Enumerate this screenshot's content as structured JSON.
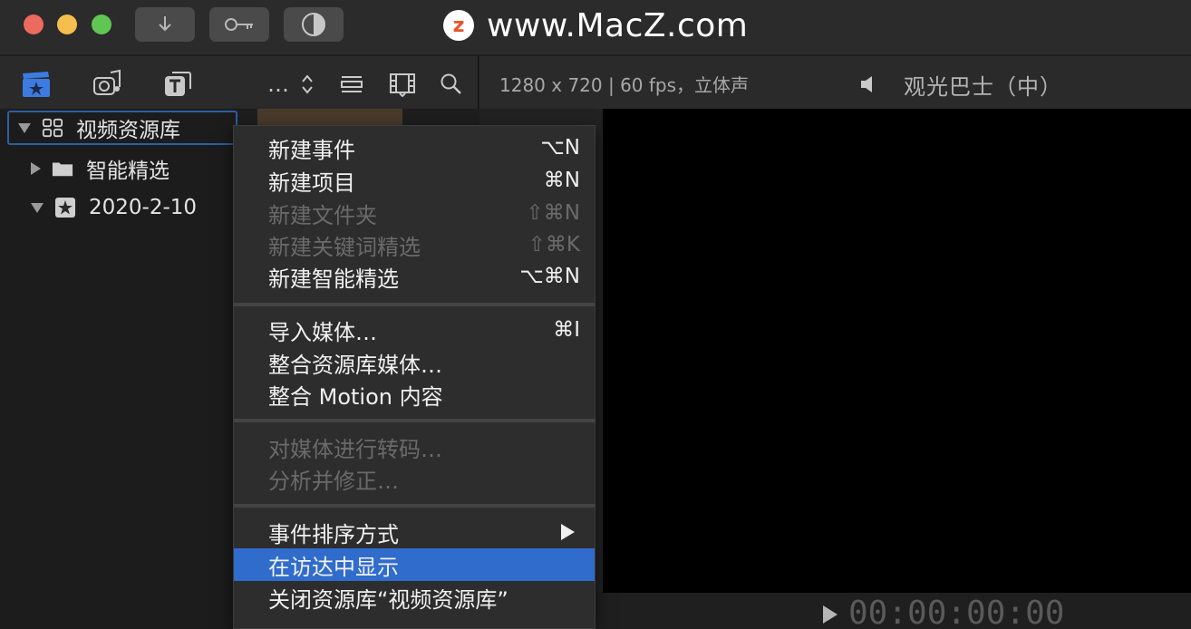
{
  "titlebar": {
    "watermark_logo": "z",
    "watermark_text": "www.MacZ.com",
    "buttons": [
      "download-icon",
      "key-icon",
      "half-circle-icon"
    ]
  },
  "browser_toolbar": {
    "icons": [
      "clapboard-star-icon",
      "music-camera-icon",
      "titles-icon",
      "more-icon",
      "updown-chevron-icon",
      "filmstrip-list-icon",
      "clip-appearance-icon",
      "search-icon"
    ],
    "more_label": "…"
  },
  "viewer_toolbar": {
    "format_info": "1280 x 720 | 60 fps，立体声",
    "project_title": "观光巴士（中）"
  },
  "sidebar": {
    "items": [
      {
        "label": "视频资源库",
        "icon": "library-grid-icon",
        "expanded": true
      },
      {
        "label": "智能精选",
        "icon": "folder-icon",
        "expanded": false
      },
      {
        "label": "2020-2-10",
        "icon": "event-star-icon",
        "expanded": true
      }
    ]
  },
  "context_menu": {
    "groups": [
      [
        {
          "label": "新建事件",
          "shortcut": "⌥N",
          "disabled": false
        },
        {
          "label": "新建项目",
          "shortcut": "⌘N",
          "disabled": false
        },
        {
          "label": "新建文件夹",
          "shortcut": "⇧⌘N",
          "disabled": true
        },
        {
          "label": "新建关键词精选",
          "shortcut": "⇧⌘K",
          "disabled": true
        },
        {
          "label": "新建智能精选",
          "shortcut": "⌥⌘N",
          "disabled": false
        }
      ],
      [
        {
          "label": "导入媒体…",
          "shortcut": "⌘I",
          "disabled": false
        },
        {
          "label": "整合资源库媒体…",
          "shortcut": "",
          "disabled": false
        },
        {
          "label": "整合 Motion 内容",
          "shortcut": "",
          "disabled": false
        }
      ],
      [
        {
          "label": "对媒体进行转码…",
          "shortcut": "",
          "disabled": true
        },
        {
          "label": "分析并修正…",
          "shortcut": "",
          "disabled": true
        }
      ],
      [
        {
          "label": "事件排序方式",
          "shortcut": "",
          "disabled": false,
          "submenu": true
        },
        {
          "label": "在访达中显示",
          "shortcut": "",
          "disabled": false,
          "selected": true
        },
        {
          "label": "关闭资源库“视频资源库”",
          "shortcut": "",
          "disabled": false
        }
      ]
    ]
  },
  "playback": {
    "timecode": "00:00:00:00"
  },
  "colors": {
    "selection": "#2f6ccc",
    "accent_blue": "#3d7be0"
  }
}
